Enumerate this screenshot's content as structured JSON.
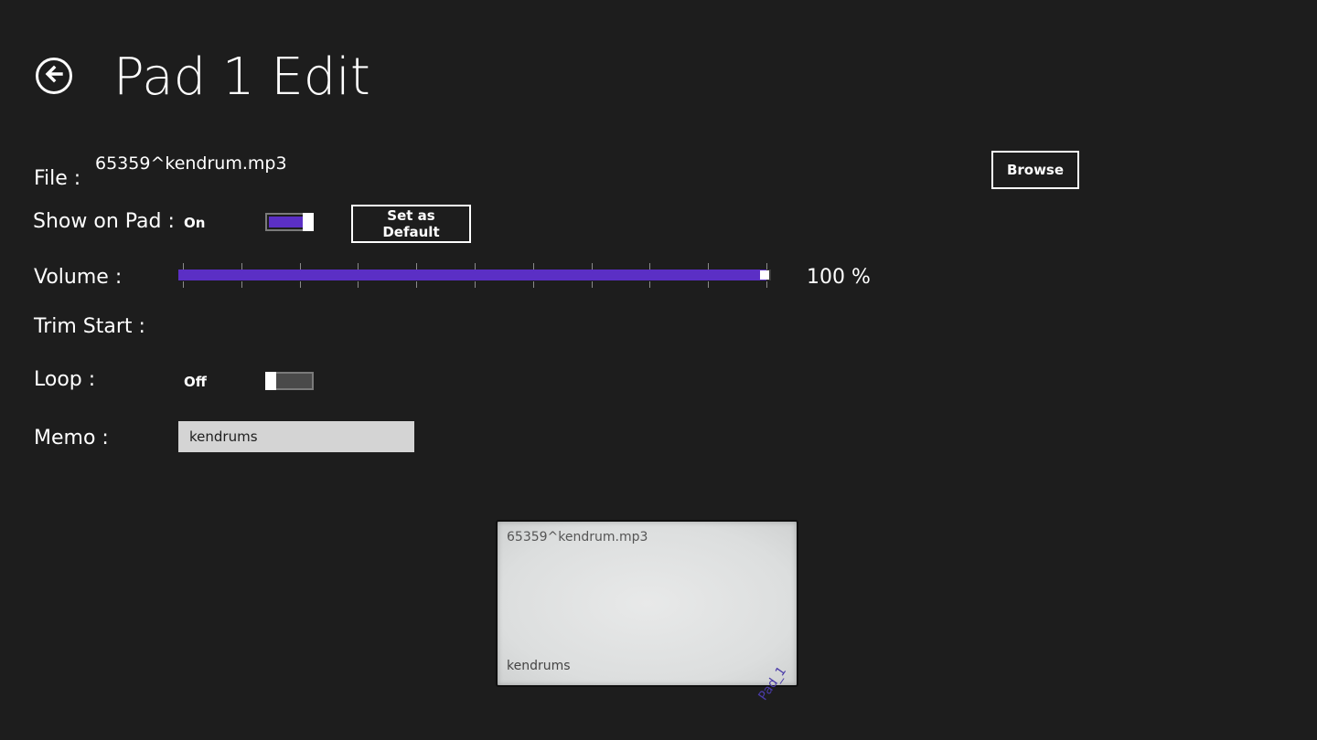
{
  "header": {
    "back_icon": "arrow-left-circle-icon",
    "title": "Pad 1 Edit"
  },
  "file": {
    "label": "File :",
    "name": "65359^kendrum.mp3",
    "browse_label": "Browse"
  },
  "show_on_pad": {
    "label": "Show on Pad :",
    "state": "On",
    "value": true,
    "set_default_label": "Set as Default"
  },
  "volume": {
    "label": "Volume :",
    "value": 100,
    "display": "100 %"
  },
  "trim_start": {
    "label": "Trim Start :"
  },
  "loop": {
    "label": "Loop :",
    "state": "Off",
    "value": false
  },
  "memo": {
    "label": "Memo :",
    "value": "kendrums"
  },
  "pad_preview": {
    "file": "65359^kendrum.mp3",
    "memo": "kendrums",
    "pad_name": "Pad_1"
  },
  "colors": {
    "accent": "#5b2fc5",
    "background": "#1d1d1d"
  }
}
